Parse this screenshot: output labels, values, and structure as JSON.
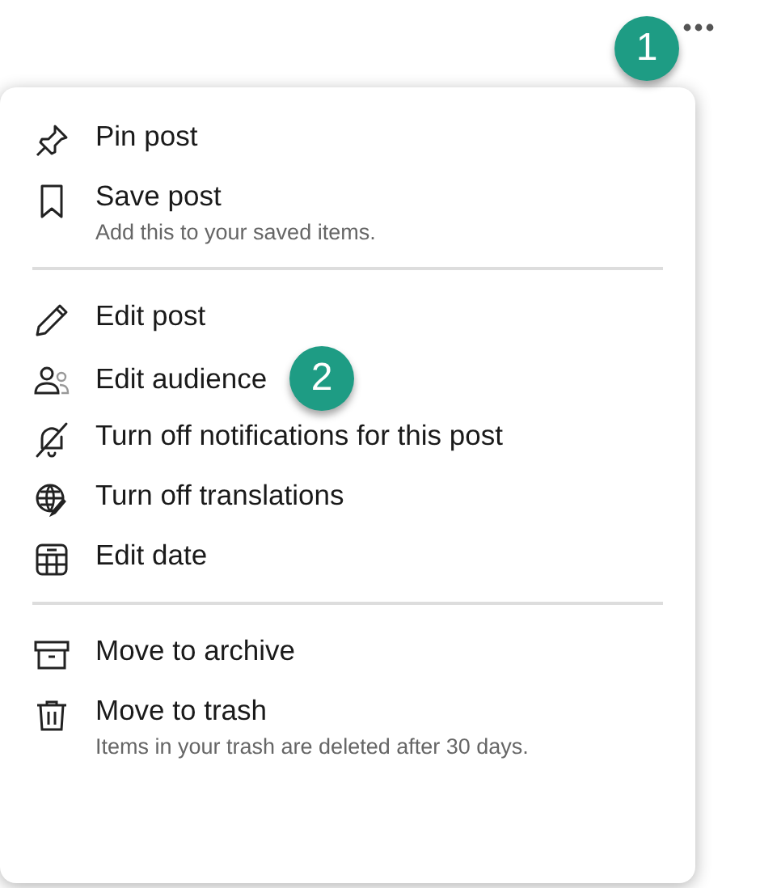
{
  "more_button": {
    "callout": "1"
  },
  "menu": {
    "sections": [
      {
        "items": [
          {
            "label": "Pin post"
          },
          {
            "label": "Save post",
            "description": "Add this to your saved items."
          }
        ]
      },
      {
        "items": [
          {
            "label": "Edit post"
          },
          {
            "label": "Edit audience",
            "callout": "2"
          },
          {
            "label": "Turn off notifications for this post"
          },
          {
            "label": "Turn off translations"
          },
          {
            "label": "Edit date"
          }
        ]
      },
      {
        "items": [
          {
            "label": "Move to archive"
          },
          {
            "label": "Move to trash",
            "description": "Items in your trash are deleted after 30 days."
          }
        ]
      }
    ]
  }
}
